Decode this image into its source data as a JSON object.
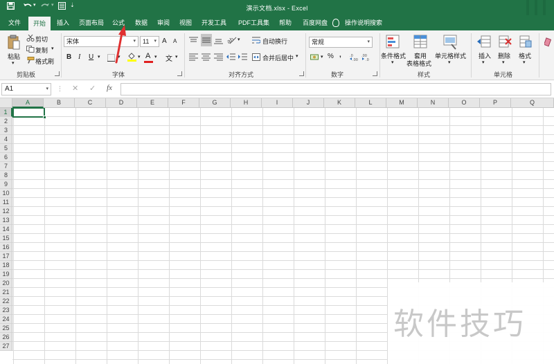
{
  "window": {
    "title": "演示文档.xlsx  -  Excel"
  },
  "quick_access": {
    "save_icon": "save-icon",
    "undo_icon": "undo-icon",
    "redo_icon": "redo-icon",
    "form_icon": "form-icon"
  },
  "tabs": [
    {
      "label": "文件"
    },
    {
      "label": "开始",
      "active": true
    },
    {
      "label": "插入"
    },
    {
      "label": "页面布局"
    },
    {
      "label": "公式"
    },
    {
      "label": "数据"
    },
    {
      "label": "审阅"
    },
    {
      "label": "视图"
    },
    {
      "label": "开发工具"
    },
    {
      "label": "PDF工具集"
    },
    {
      "label": "帮助"
    },
    {
      "label": "百度网盘"
    }
  ],
  "tell_me": "操作说明搜索",
  "ribbon": {
    "clipboard": {
      "paste": "粘贴",
      "cut": "剪切",
      "copy": "复制",
      "format_painter": "格式刷",
      "label": "剪贴板"
    },
    "font": {
      "font_name": "宋体",
      "font_size": "11",
      "grow": "A",
      "shrink": "A",
      "bold": "B",
      "italic": "I",
      "underline": "U",
      "font_color_glyph": "A",
      "phonetic_glyph": "文",
      "label": "字体",
      "font_color": "#e02020",
      "fill_color": "#ffff00"
    },
    "alignment": {
      "wrap": "自动换行",
      "merge": "合并后居中",
      "label": "对齐方式"
    },
    "number": {
      "format": "常规",
      "percent": "%",
      "comma": ",",
      "label": "数字"
    },
    "styles": {
      "conditional": "条件格式",
      "table_1": "套用",
      "table_2": "表格格式",
      "cell_styles": "单元格样式",
      "label": "样式"
    },
    "cells": {
      "insert": "插入",
      "delete": "删除",
      "format": "格式",
      "label": "单元格"
    }
  },
  "formula_bar": {
    "name_box": "A1",
    "cancel": "✕",
    "enter": "✓",
    "fx": "fx",
    "value": ""
  },
  "grid": {
    "columns": [
      "A",
      "B",
      "C",
      "D",
      "E",
      "F",
      "G",
      "H",
      "I",
      "J",
      "K",
      "L",
      "M",
      "N",
      "O",
      "P",
      "Q"
    ],
    "rows": [
      "1",
      "2",
      "3",
      "4",
      "5",
      "6",
      "7",
      "8",
      "9",
      "10",
      "11",
      "12",
      "13",
      "14",
      "15",
      "16",
      "17",
      "18",
      "19",
      "20",
      "21",
      "22",
      "23",
      "24",
      "25",
      "26",
      "27"
    ],
    "active_cell": "A1"
  },
  "watermark": "软件技巧",
  "colors": {
    "accent": "#217346",
    "annotation_arrow": "#e03030"
  }
}
